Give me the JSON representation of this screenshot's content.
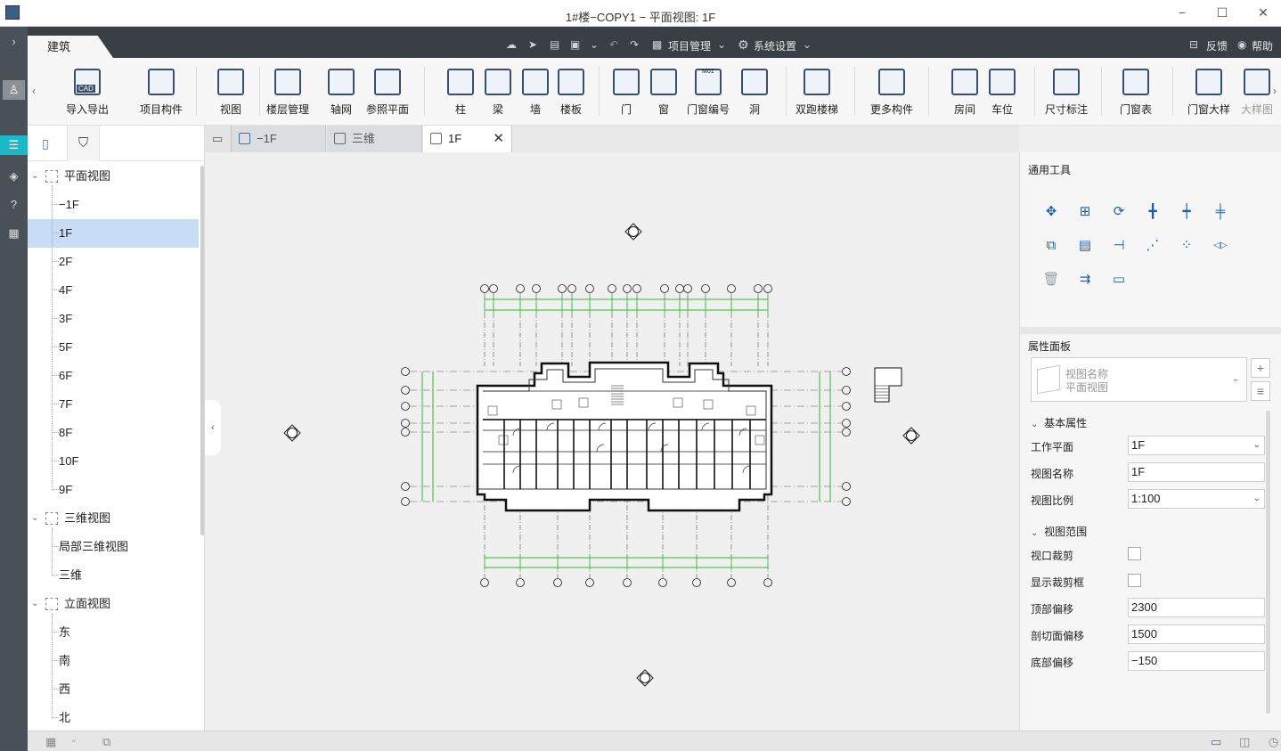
{
  "window": {
    "title": "1#楼−COPY1 − 平面视图: 1F",
    "min": "−",
    "max": "☐",
    "close": "✕"
  },
  "menubar": {
    "active_tab": "建筑",
    "project_menu": "项目管理",
    "settings_menu": "系统设置",
    "feedback": "反馈",
    "help": "帮助"
  },
  "ribbon": {
    "items": [
      {
        "label": "导入导出",
        "icon": "cad-import-icon"
      },
      {
        "label": "项目构件",
        "icon": "project-component-icon"
      },
      {
        "label": "视图",
        "icon": "view-icon"
      },
      {
        "label": "楼层管理",
        "icon": "floor-manage-icon"
      },
      {
        "label": "轴网",
        "icon": "grid-axis-icon"
      },
      {
        "label": "参照平面",
        "icon": "reference-plane-icon"
      },
      {
        "label": "柱",
        "icon": "column-icon"
      },
      {
        "label": "梁",
        "icon": "beam-icon"
      },
      {
        "label": "墙",
        "icon": "wall-icon"
      },
      {
        "label": "楼板",
        "icon": "slab-icon"
      },
      {
        "label": "门",
        "icon": "door-icon"
      },
      {
        "label": "窗",
        "icon": "window-icon"
      },
      {
        "label": "门窗编号",
        "icon": "door-window-tag-icon"
      },
      {
        "label": "洞",
        "icon": "opening-icon"
      },
      {
        "label": "双跑楼梯",
        "icon": "stair-icon"
      },
      {
        "label": "更多构件",
        "icon": "more-components-icon"
      },
      {
        "label": "房间",
        "icon": "room-icon"
      },
      {
        "label": "车位",
        "icon": "parking-icon"
      },
      {
        "label": "尺寸标注",
        "icon": "dimension-icon"
      },
      {
        "label": "门窗表",
        "icon": "door-window-table-icon"
      },
      {
        "label": "门窗大样",
        "icon": "door-window-detail-icon"
      },
      {
        "label": "大样图",
        "icon": "detail-drawing-icon"
      }
    ],
    "cad_label": "CAD",
    "tag_label": "M01"
  },
  "tree": {
    "groups": [
      {
        "label": "平面视图",
        "children": [
          "−1F",
          "1F",
          "2F",
          "4F",
          "3F",
          "5F",
          "6F",
          "7F",
          "8F",
          "10F",
          "9F"
        ]
      },
      {
        "label": "三维视图",
        "children": [
          "局部三维视图",
          "三维"
        ]
      },
      {
        "label": "立面视图",
        "children": [
          "东",
          "南",
          "西",
          "北"
        ]
      }
    ],
    "selected": "1F"
  },
  "tabs": [
    {
      "label": "−1F"
    },
    {
      "label": "三维"
    },
    {
      "label": "1F",
      "active": true
    }
  ],
  "right_panel": {
    "tools_title": "通用工具",
    "props_title": "属性面板",
    "view_name_hint": "视图名称",
    "view_name_value": "平面视图",
    "basic_group": "基本属性",
    "range_group": "视图范围",
    "basic": [
      {
        "key": "工作平面",
        "value": "1F",
        "type": "select"
      },
      {
        "key": "视图名称",
        "value": "1F",
        "type": "text"
      },
      {
        "key": "视图比例",
        "value": "1:100",
        "type": "select"
      }
    ],
    "range": [
      {
        "key": "视口裁剪",
        "type": "checkbox"
      },
      {
        "key": "显示裁剪框",
        "type": "checkbox"
      },
      {
        "key": "顶部偏移",
        "value": "2300",
        "type": "text"
      },
      {
        "key": "剖切面偏移",
        "value": "1500",
        "type": "text"
      },
      {
        "key": "底部偏移",
        "value": "−150",
        "type": "text"
      }
    ]
  },
  "colors": {
    "accent": "#1bb8c8",
    "grid_green": "#2cc02c",
    "selection": "#c7dcf5",
    "dark": "#3a3f45"
  }
}
